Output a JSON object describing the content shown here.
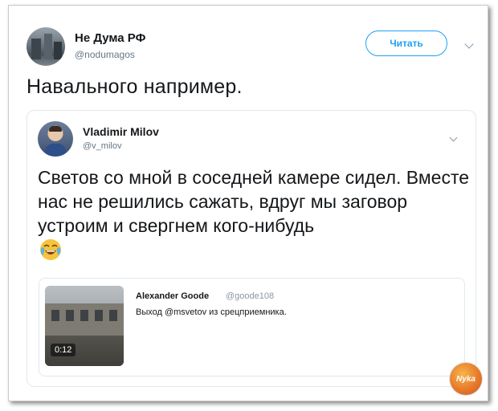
{
  "tweet": {
    "author_name": "Не Дума РФ",
    "author_handle": "@nodumagos",
    "follow_label": "Читать",
    "text": "Навального например."
  },
  "quoted": {
    "author_name": "Vladimir Milov",
    "author_handle": "@v_milov",
    "text": "Светов со мной в соседней камере сидел. Вместе нас не решились сажать, вдруг мы заговор устроим и свергнем кого-нибудь",
    "card": {
      "author_name": "Alexander Goode",
      "author_handle": "@goode108",
      "text": "Выход @msvetov из срецприемника.",
      "video_duration": "0:12"
    }
  },
  "icons": {
    "more_main": "chevron-down-icon",
    "more_quoted": "chevron-down-icon",
    "emoji": "face-with-tears-of-joy-emoji"
  },
  "colors": {
    "accent": "#1da1f2",
    "text": "#14171a",
    "secondary": "#657786",
    "border": "#e1e8ed"
  }
}
